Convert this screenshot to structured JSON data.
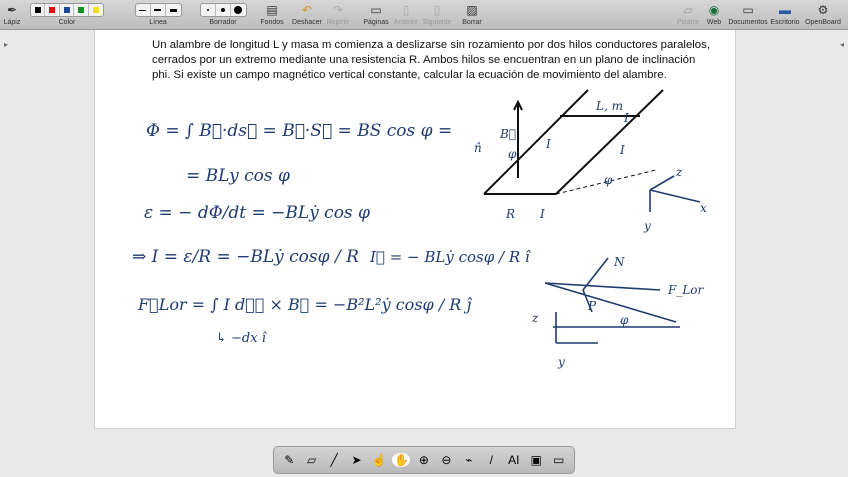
{
  "toolbar": {
    "left": [
      {
        "label": "Lápiz",
        "icon": "pen-icon"
      },
      {
        "label": "Color",
        "icon": "color-swatches"
      },
      {
        "label": "Línea",
        "icon": "line-width"
      },
      {
        "label": "Borrador",
        "icon": "eraser-size"
      },
      {
        "label": "Fondos",
        "icon": "backgrounds-icon"
      },
      {
        "label": "Deshacer",
        "icon": "undo-icon"
      },
      {
        "label": "Repetir",
        "icon": "redo-icon"
      },
      {
        "label": "Páginas",
        "icon": "pages-icon"
      },
      {
        "label": "Anterior",
        "icon": "previous-icon"
      },
      {
        "label": "Siguiente",
        "icon": "next-icon"
      },
      {
        "label": "Borrar",
        "icon": "clear-icon"
      }
    ],
    "colors": [
      "#000000",
      "#e01010",
      "#1a4aa0",
      "#109020",
      "#f0e020"
    ],
    "right": [
      {
        "label": "Pizarra",
        "icon": "board-icon"
      },
      {
        "label": "Web",
        "icon": "globe-icon"
      },
      {
        "label": "Documentos",
        "icon": "folder-icon"
      },
      {
        "label": "Escritorio",
        "icon": "desktop-icon"
      },
      {
        "label": "OpenBoard",
        "icon": "gear-icon"
      }
    ]
  },
  "problem": "Un alambre de longitud L y masa m comienza a deslizarse sin rozamiento por dos hilos conductores paralelos, cerrados por un extremo mediante una resistencia R. Ambos hilos se encuentran en un plano de inclinación phi. Si existe un campo magnético vertical constante, calcular la ecuación de movimiento del alambre.",
  "handwriting": {
    "l1": "Φ = ∫ B⃗·ds⃗ = B⃗·S⃗ = BS cos φ =",
    "l2": "= BLy cos φ",
    "l3": "ε = − dΦ/dt = −BLẏ cos φ",
    "l4": "⇒ I = ε/R = −BLẏ cosφ / R",
    "l5": "I⃗ = − BLẏ cosφ / R  î",
    "l6": "F⃗Lor = ∫ I dℓ⃗ × B⃗  =  −B²L²ẏ cosφ / R  ĵ",
    "l7": "↳ −dx î",
    "diagram_labels": [
      "B⃗",
      "n̂",
      "φ",
      "I",
      "I",
      "L, m",
      "I",
      "R",
      "I",
      "φ",
      "z",
      "x",
      "y",
      "N",
      "F_Lor",
      "P",
      "φ",
      "z",
      "y"
    ]
  },
  "dock": [
    {
      "name": "pen-tool",
      "glyph": "✎"
    },
    {
      "name": "eraser-tool",
      "glyph": "▱"
    },
    {
      "name": "highlighter-tool",
      "glyph": "╱"
    },
    {
      "name": "select-tool",
      "glyph": "➤"
    },
    {
      "name": "pointer-hand-tool",
      "glyph": "☝"
    },
    {
      "name": "hand-tool",
      "glyph": "✋"
    },
    {
      "name": "zoom-in-tool",
      "glyph": "⊕"
    },
    {
      "name": "zoom-out-tool",
      "glyph": "⊖"
    },
    {
      "name": "laser-tool",
      "glyph": "⌁"
    },
    {
      "name": "line-tool",
      "glyph": "/"
    },
    {
      "name": "text-tool",
      "glyph": "AI"
    },
    {
      "name": "capture-tool",
      "glyph": "▣"
    },
    {
      "name": "keyboard-tool",
      "glyph": "▭"
    }
  ]
}
